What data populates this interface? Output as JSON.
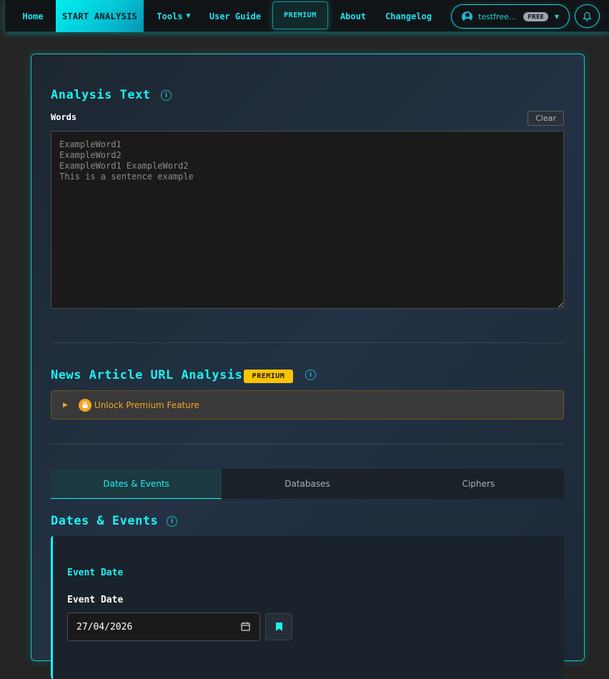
{
  "nav": {
    "home": "Home",
    "start_analysis": "START ANALYSIS",
    "tools": "Tools",
    "user_guide": "User Guide",
    "premium": "PREMIUM",
    "about": "About",
    "changelog": "Changelog"
  },
  "user": {
    "name": "testfree...",
    "plan_badge": "FREE"
  },
  "analysis_text": {
    "title": "Analysis Text",
    "words_label": "Words",
    "clear_label": "Clear",
    "placeholder": "ExampleWord1\nExampleWord2\nExampleWord1 ExampleWord2\nThis is a sentence example"
  },
  "news": {
    "title": "News Article URL Analysis",
    "badge": "PREMIUM",
    "unlock_label": "Unlock Premium Feature"
  },
  "tabs": [
    "Dates & Events",
    "Databases",
    "Ciphers"
  ],
  "dates_events": {
    "title": "Dates & Events",
    "card_title": "Event Date",
    "field_label": "Event Date",
    "date_value": "27/04/2026"
  },
  "colors": {
    "accent": "#1ff0f0",
    "premium_badge": "#ffc400",
    "unlock_text": "#f5a623"
  }
}
